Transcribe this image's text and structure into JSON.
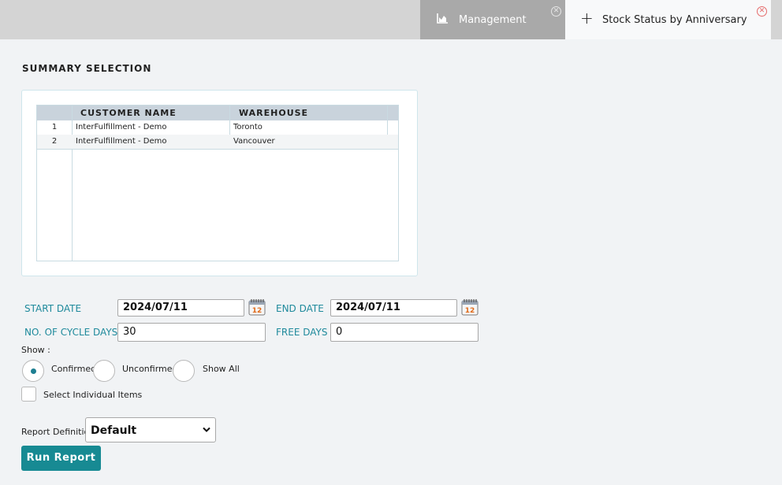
{
  "tabs": [
    {
      "label": "Management",
      "icon": "area-chart-icon",
      "active": false
    },
    {
      "label": "Stock Status by Anniversary",
      "icon": "plus-icon",
      "active": true
    }
  ],
  "section_title": "SUMMARY SELECTION",
  "grid": {
    "columns": [
      "CUSTOMER NAME",
      "WAREHOUSE"
    ],
    "rows": [
      {
        "num": "1",
        "customer": "InterFulfillment - Demo",
        "warehouse": "Toronto"
      },
      {
        "num": "2",
        "customer": "InterFulfillment - Demo",
        "warehouse": "Vancouver"
      }
    ]
  },
  "form": {
    "start_date_label": "START DATE",
    "start_date": "2024/07/11",
    "end_date_label": "END DATE",
    "end_date": "2024/07/11",
    "cycle_days_label": "NO. OF CYCLE DAYS",
    "cycle_days": "30",
    "free_days_label": "FREE DAYS",
    "free_days": "0",
    "calendar_icon_text": "12"
  },
  "show": {
    "label": "Show :",
    "options": [
      "Confirmed",
      "Unconfirmed",
      "Show All"
    ],
    "selected": "Confirmed"
  },
  "select_individual_label": "Select Individual Items",
  "report_definition": {
    "label": "Report Definition",
    "value": "Default"
  },
  "run_button_label": "Run Report",
  "colors": {
    "accent": "#178a93",
    "label_teal": "#1f8a9c",
    "close_red": "#e56b6b"
  }
}
